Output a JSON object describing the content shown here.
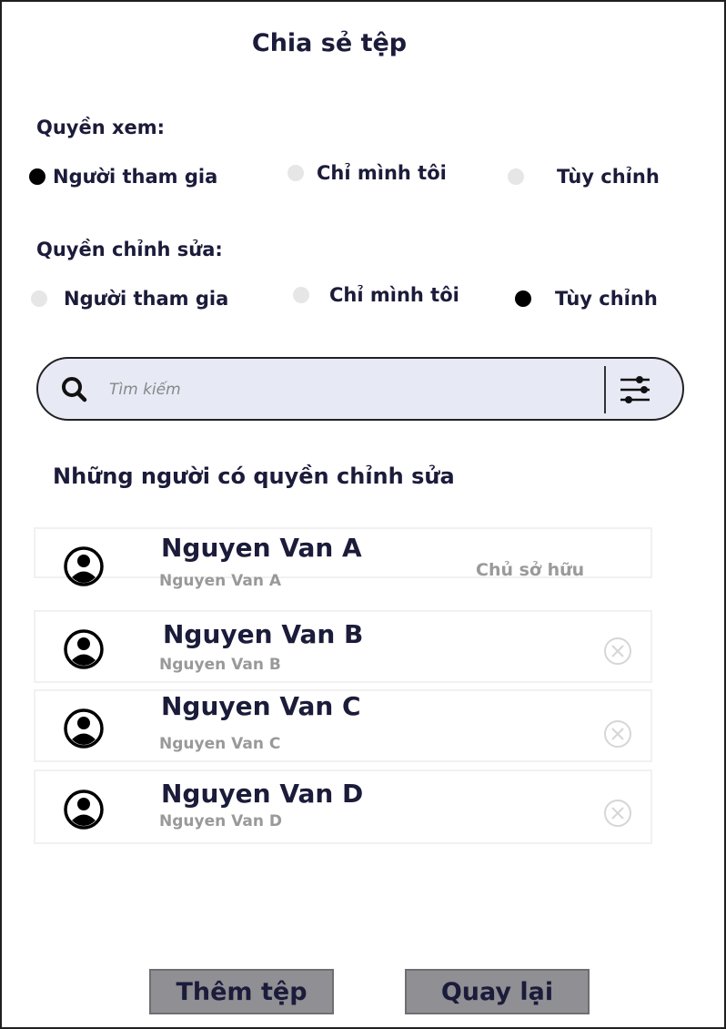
{
  "title": "Chia sẻ tệp",
  "view_permission": {
    "label": "Quyền xem:",
    "options": [
      {
        "label": "Người tham gia",
        "selected": true
      },
      {
        "label": "Chỉ mình tôi",
        "selected": false
      },
      {
        "label": "Tùy chỉnh",
        "selected": false
      }
    ]
  },
  "edit_permission": {
    "label": "Quyền chỉnh sửa:",
    "options": [
      {
        "label": "Người tham gia",
        "selected": false
      },
      {
        "label": "Chỉ mình tôi",
        "selected": false
      },
      {
        "label": "Tùy chỉnh",
        "selected": true
      }
    ]
  },
  "search": {
    "placeholder": "Tìm kiếm",
    "value": "",
    "search_icon": "search-icon",
    "filter_icon": "sliders-icon"
  },
  "editors": {
    "heading": "Những người có quyền chỉnh sửa",
    "items": [
      {
        "name": "Nguyen Van A",
        "subtitle": "Nguyen Van A",
        "role": "Chủ sở hữu",
        "avatar_icon": "user-circle-icon"
      },
      {
        "name": "Nguyen Van B",
        "subtitle": "Nguyen Van B",
        "role": "",
        "avatar_icon": "user-circle-icon",
        "action_icon": "close-circle-icon"
      },
      {
        "name": "Nguyen Van C",
        "subtitle": "Nguyen Van C",
        "role": "",
        "avatar_icon": "user-circle-icon",
        "action_icon": "close-circle-icon"
      },
      {
        "name": "Nguyen Van D",
        "subtitle": "Nguyen Van D",
        "role": "",
        "avatar_icon": "user-circle-icon",
        "action_icon": "close-circle-icon"
      }
    ]
  },
  "buttons": {
    "add_label": "Thêm tệp",
    "back_label": "Quay lại"
  },
  "colors": {
    "search_bg": "#e7e9f5",
    "button_bg": "#8f8f94",
    "text_dark": "#1b1b3a",
    "text_muted": "#999999"
  }
}
